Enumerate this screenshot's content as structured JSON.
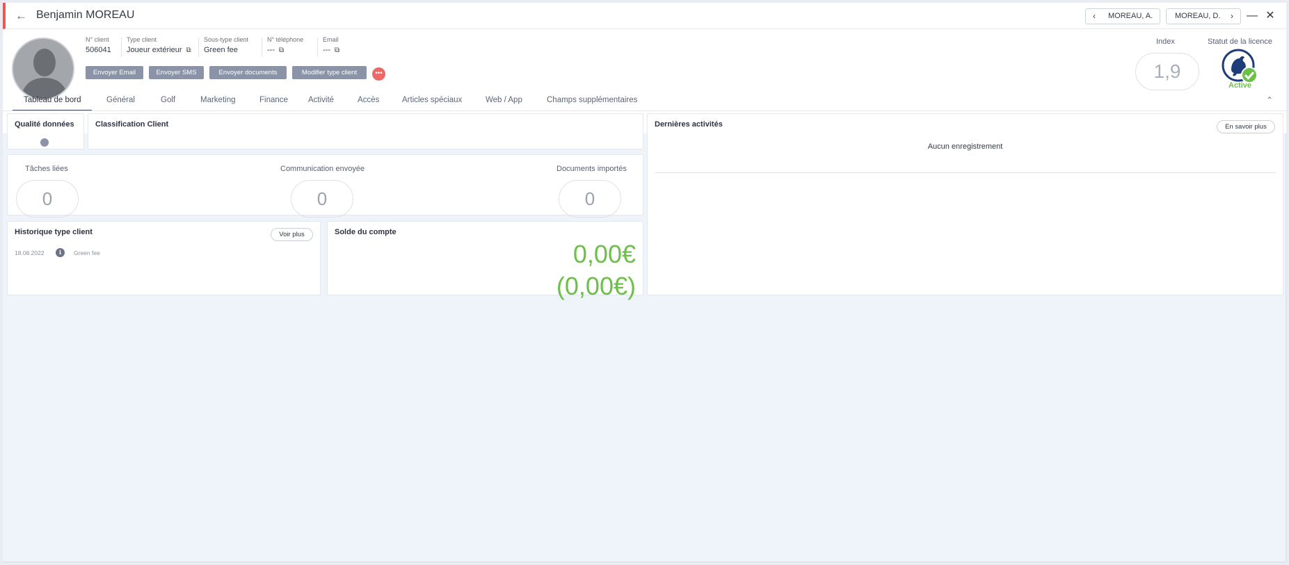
{
  "window": {
    "title": "Benjamin MOREAU",
    "prev_label": "MOREAU, A.",
    "next_label": "MOREAU, D."
  },
  "client": {
    "number_label": "N° client",
    "number": "506041",
    "type_label": "Type client",
    "type": "Joueur extérieur",
    "subtype_label": "Sous-type client",
    "subtype": "Green fee",
    "phone_label": "N° téléphone",
    "phone": "---",
    "email_label": "Email",
    "email": "---"
  },
  "actions": {
    "send_email": "Envoyer Email",
    "send_sms": "Envoyer SMS",
    "send_documents": "Envoyer documents",
    "modify_type": "Modifier type client",
    "more": "•••"
  },
  "index": {
    "label": "Index",
    "value": "1,9"
  },
  "license": {
    "label": "Statut de la licence",
    "status": "Active",
    "badge_icon": "rooster-check-icon"
  },
  "tabs": [
    {
      "label": "Tableau de bord"
    },
    {
      "label": "Général"
    },
    {
      "label": "Golf"
    },
    {
      "label": "Marketing"
    },
    {
      "label": "Finance"
    },
    {
      "label": "Activité"
    },
    {
      "label": "Accès"
    },
    {
      "label": "Articles spéciaux"
    },
    {
      "label": "Web / App"
    },
    {
      "label": "Champs supplémentaires"
    }
  ],
  "dashboard": {
    "quality_title": "Qualité données",
    "classification_title": "Classification Client",
    "stats": [
      {
        "label": "Tâches liées",
        "value": "0"
      },
      {
        "label": "Communication envoyée",
        "value": "0"
      },
      {
        "label": "Documents importés",
        "value": "0"
      }
    ],
    "history": {
      "title": "Historique type client",
      "button": "Voir plus",
      "date": "18.08.2022",
      "value": "Green fee"
    },
    "balance": {
      "title": "Solde du compte",
      "main": "0,00€",
      "secondary": "(0,00€)"
    },
    "activities": {
      "title": "Dernières activités",
      "button": "En savoir plus",
      "empty": "Aucun enregistrement"
    }
  },
  "colors": {
    "accent_red": "#e25b56",
    "positive_green": "#6cc04a",
    "button_gray": "#8a93a8"
  }
}
